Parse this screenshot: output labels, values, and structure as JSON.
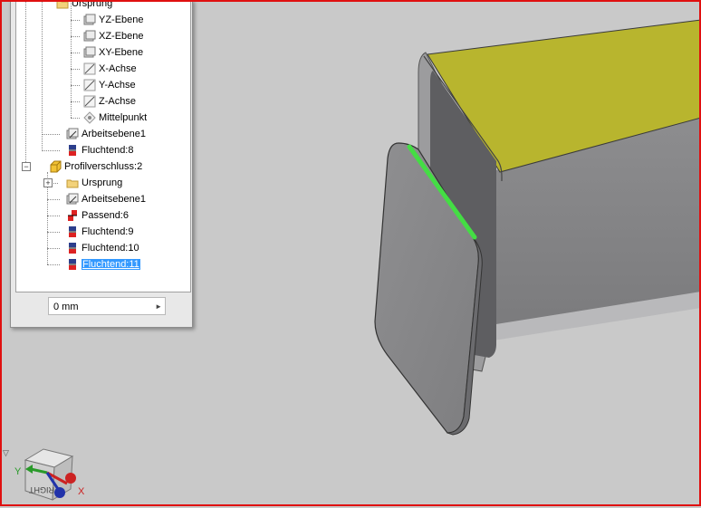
{
  "browser": {
    "tree": [
      {
        "label": "Ursprung",
        "icon": "folder-icon"
      },
      {
        "label": "YZ-Ebene",
        "icon": "plane-icon"
      },
      {
        "label": "XZ-Ebene",
        "icon": "plane-icon"
      },
      {
        "label": "XY-Ebene",
        "icon": "plane-icon"
      },
      {
        "label": "X-Achse",
        "icon": "axis-icon"
      },
      {
        "label": "Y-Achse",
        "icon": "axis-icon"
      },
      {
        "label": "Z-Achse",
        "icon": "axis-icon"
      },
      {
        "label": "Mittelpunkt",
        "icon": "center-point-icon"
      },
      {
        "label": "Arbeitsebene1",
        "icon": "work-plane-icon"
      },
      {
        "label": "Fluchtend:8",
        "icon": "flush-constraint-icon"
      },
      {
        "label": "Profilverschluss:2",
        "icon": "part-icon"
      },
      {
        "label": "Ursprung",
        "icon": "folder-icon"
      },
      {
        "label": "Arbeitsebene1",
        "icon": "work-plane-icon"
      },
      {
        "label": "Passend:6",
        "icon": "mate-constraint-icon"
      },
      {
        "label": "Fluchtend:9",
        "icon": "flush-constraint-icon"
      },
      {
        "label": "Fluchtend:10",
        "icon": "flush-constraint-icon"
      },
      {
        "label": "Fluchtend:11",
        "icon": "flush-constraint-icon"
      }
    ],
    "selected_item": "Fluchtend:11",
    "offset_value": "0 mm"
  },
  "viewcube": {
    "face_label": "RIGHT",
    "axis_x": "X",
    "axis_y": "Y"
  },
  "colors": {
    "selection": "#3399ff",
    "highlight_edge": "#44dd44",
    "top_face": "#b8b52e",
    "background": "#c9c9c9",
    "border": "#e01010"
  }
}
